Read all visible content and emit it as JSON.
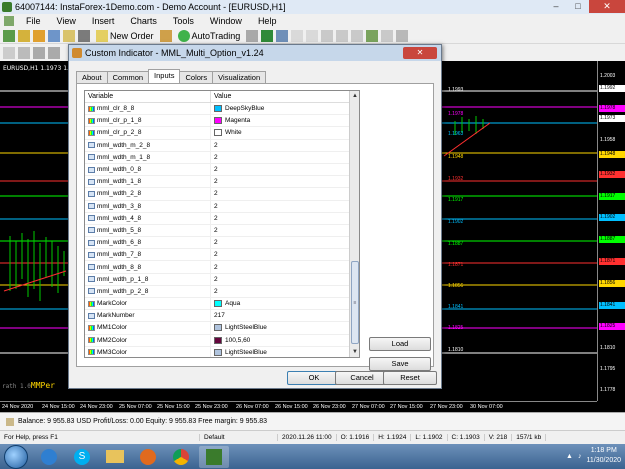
{
  "window": {
    "title": "64007144: InstaForex-1Demo.com - Demo Account - [EURUSD,H1]"
  },
  "menu": [
    "File",
    "View",
    "Insert",
    "Charts",
    "Tools",
    "Window",
    "Help"
  ],
  "toolbar": {
    "new_order": "New Order",
    "autotrading": "AutoTrading"
  },
  "chart": {
    "title": "EURUSD,H1  1.1973 1.1973 1.1973 1.1973",
    "price_labels": [
      "1.2003",
      "1.1992",
      "1.1978",
      "1.1973",
      "1.1958",
      "1.1948",
      "1.1932",
      "1.1917",
      "1.1902",
      "1.1887",
      "1.1871",
      "1.1856",
      "1.1841",
      "1.1825",
      "1.1810",
      "1.1795",
      "1.1778"
    ],
    "level_labels": [
      "1.1993",
      "1.1978",
      "1.1963",
      "1.1948",
      "1.1932",
      "1.1917",
      "1.1902",
      "1.1887",
      "1.1871",
      "1.1856",
      "1.1841",
      "1.1825",
      "1.1810"
    ],
    "time_labels": [
      "24 Nov 2020",
      "24 Nov 15:00",
      "24 Nov 23:00",
      "25 Nov 07:00",
      "25 Nov 15:00",
      "25 Nov 23:00",
      "26 Nov 07:00",
      "26 Nov 15:00",
      "26 Nov 23:00",
      "27 Nov 07:00",
      "27 Nov 15:00",
      "27 Nov 23:00",
      "30 Nov 07:00"
    ],
    "indicator_text": "MMPer",
    "indicator_prefix": "rath 1.0"
  },
  "dialog": {
    "title": "Custom Indicator - MML_Multi_Option_v1.24",
    "close": "✕",
    "tabs": [
      "About",
      "Common",
      "Inputs",
      "Colors",
      "Visualization"
    ],
    "col_variable": "Variable",
    "col_value": "Value",
    "rows": [
      {
        "name": "mml_clr_8_8",
        "value": "DeepSkyBlue",
        "color": "#00bfff",
        "type": "color"
      },
      {
        "name": "mml_clr_p_1_8",
        "value": "Magenta",
        "color": "#ff00ff",
        "type": "color"
      },
      {
        "name": "mml_clr_p_2_8",
        "value": "White",
        "color": "#ffffff",
        "type": "color"
      },
      {
        "name": "mml_wdth_m_2_8",
        "value": "2",
        "type": "int"
      },
      {
        "name": "mml_wdth_m_1_8",
        "value": "2",
        "type": "int"
      },
      {
        "name": "mml_wdth_0_8",
        "value": "2",
        "type": "int"
      },
      {
        "name": "mml_wdth_1_8",
        "value": "2",
        "type": "int"
      },
      {
        "name": "mml_wdth_2_8",
        "value": "2",
        "type": "int"
      },
      {
        "name": "mml_wdth_3_8",
        "value": "2",
        "type": "int"
      },
      {
        "name": "mml_wdth_4_8",
        "value": "2",
        "type": "int"
      },
      {
        "name": "mml_wdth_5_8",
        "value": "2",
        "type": "int"
      },
      {
        "name": "mml_wdth_6_8",
        "value": "2",
        "type": "int"
      },
      {
        "name": "mml_wdth_7_8",
        "value": "2",
        "type": "int"
      },
      {
        "name": "mml_wdth_8_8",
        "value": "2",
        "type": "int"
      },
      {
        "name": "mml_wdth_p_1_8",
        "value": "2",
        "type": "int"
      },
      {
        "name": "mml_wdth_p_2_8",
        "value": "2",
        "type": "int"
      },
      {
        "name": "MarkColor",
        "value": "Aqua",
        "color": "#00ffff",
        "type": "color"
      },
      {
        "name": "MarkNumber",
        "value": "217",
        "type": "int"
      },
      {
        "name": "MM1Color",
        "value": "LightSteelBlue",
        "color": "#b0c4de",
        "type": "color"
      },
      {
        "name": "MM2Color",
        "value": "100,5,60",
        "color": "#64053c",
        "type": "color"
      },
      {
        "name": "MM3Color",
        "value": "LightSteelBlue",
        "color": "#b0c4de",
        "type": "color"
      }
    ],
    "load": "Load",
    "save": "Save",
    "ok": "OK",
    "cancel": "Cancel",
    "reset": "Reset"
  },
  "terminal": {
    "text": "Balance: 9 955.83 USD  Profit/Loss: 0.00  Equity: 9 955.83  Free margin: 9 955.83"
  },
  "status": {
    "help": "For Help, press F1",
    "profile": "Default",
    "datetime": "2020.11.26 11:00",
    "open": "O: 1.1916",
    "high": "H: 1.1924",
    "low": "L: 1.1902",
    "close": "C: 1.1903",
    "volume": "V: 218",
    "traffic": "157/1 kb"
  },
  "taskbar": {
    "time": "1:18 PM",
    "date": "11/30/2020"
  },
  "colors": {
    "accent": "#3b6390",
    "chart_bg": "#000000"
  }
}
